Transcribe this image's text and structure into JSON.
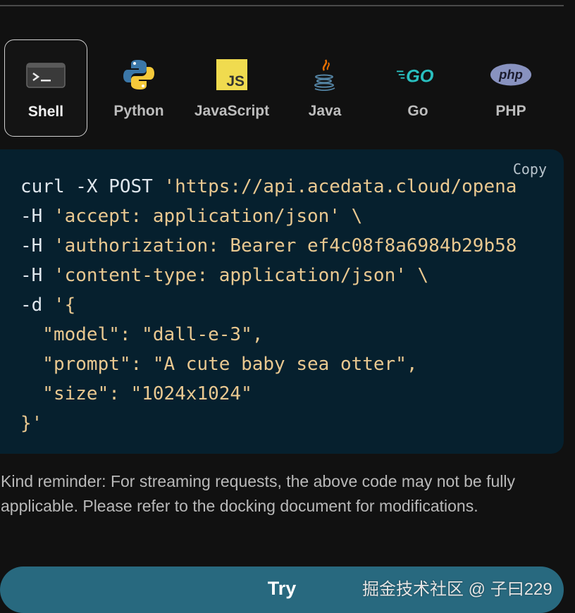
{
  "tabs": [
    {
      "label": "Shell",
      "icon": "terminal-icon",
      "active": true
    },
    {
      "label": "Python",
      "icon": "python-icon",
      "active": false
    },
    {
      "label": "JavaScript",
      "icon": "javascript-icon",
      "active": false
    },
    {
      "label": "Java",
      "icon": "java-icon",
      "active": false
    },
    {
      "label": "Go",
      "icon": "go-icon",
      "active": false
    },
    {
      "label": "PHP",
      "icon": "php-icon",
      "active": false
    }
  ],
  "code": {
    "copy_label": "Copy",
    "lines": [
      "curl -X POST 'https://api.acedata.cloud/opena",
      "-H 'accept: application/json' \\",
      "-H 'authorization: Bearer ef4c08f8a6984b29b58",
      "-H 'content-type: application/json' \\",
      "-d '{",
      "  \"model\": \"dall-e-3\",",
      "  \"prompt\": \"A cute baby sea otter\",",
      "  \"size\": \"1024x1024\"",
      "}'"
    ]
  },
  "reminder": "Kind reminder: For streaming requests, the above code may not be fully applicable. Please refer to the docking document for modifications.",
  "try_label": "Try",
  "watermark": "掘金技术社区 @ 子曰229",
  "colors": {
    "background": "#111111",
    "code_background": "#06202e",
    "code_string": "#e9c890",
    "try_button": "#28697f"
  }
}
